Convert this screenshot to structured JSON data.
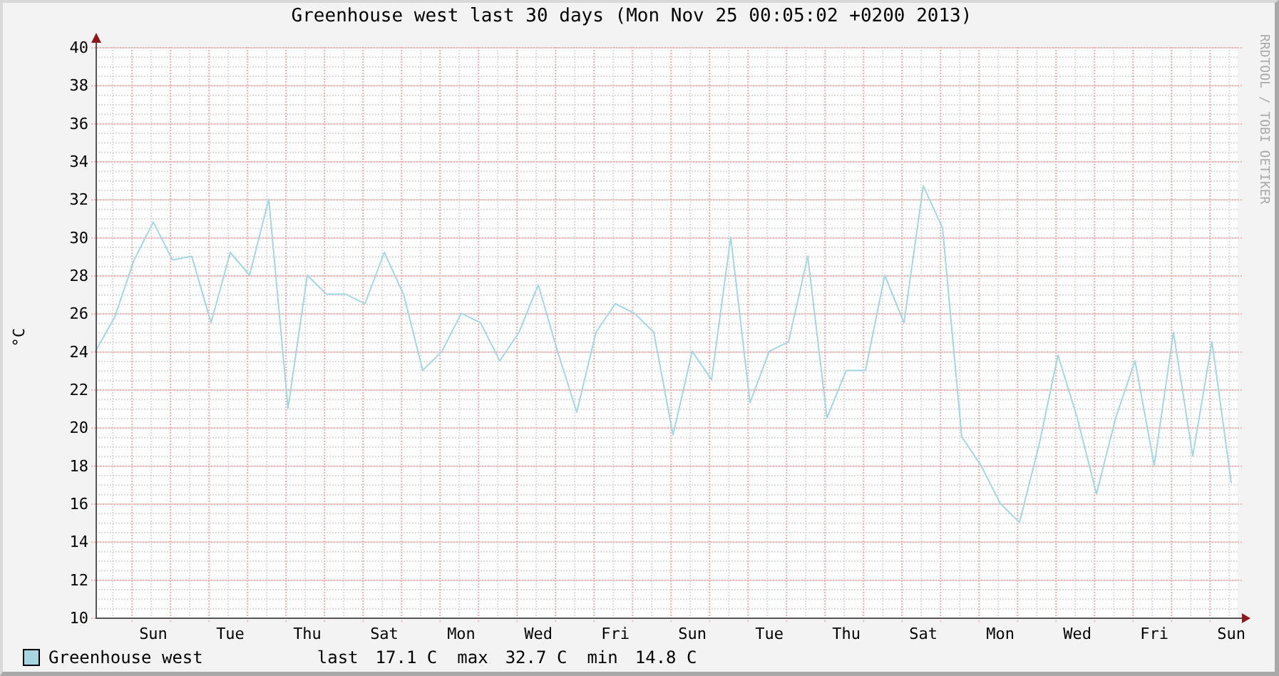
{
  "chart_data": {
    "type": "line",
    "title": "Greenhouse west last 30 days (Mon Nov 25 00:05:02 +0200 2013)",
    "ylabel": "°C",
    "categories": [
      null,
      null,
      null,
      "Sun",
      null,
      null,
      null,
      "Tue",
      null,
      null,
      null,
      "Thu",
      null,
      null,
      null,
      "Sat",
      null,
      null,
      null,
      "Mon",
      null,
      null,
      null,
      "Wed",
      null,
      null,
      null,
      "Fri",
      null,
      null,
      null,
      "Sun",
      null,
      null,
      null,
      "Tue",
      null,
      null,
      null,
      "Thu",
      null,
      null,
      null,
      "Sat",
      null,
      null,
      null,
      "Mon",
      null,
      null,
      null,
      "Wed",
      null,
      null,
      null,
      "Fri",
      null,
      null,
      null,
      "Sun"
    ],
    "series": [
      {
        "name": "Greenhouse west",
        "color": "#a6d6e2",
        "values": [
          24,
          25.8,
          28.8,
          30.8,
          28.8,
          29,
          25.5,
          29.2,
          28,
          32,
          21,
          28,
          27,
          27,
          26.5,
          29.2,
          27,
          23,
          24,
          26,
          25.5,
          23.5,
          25,
          27.5,
          24,
          20.8,
          25,
          26.5,
          26,
          25,
          19.6,
          24,
          22.5,
          30,
          21.3,
          24,
          24.5,
          29,
          20.5,
          23,
          23,
          28,
          25.5,
          32.7,
          30.5,
          19.5,
          18,
          16,
          15,
          19,
          23.8,
          20.5,
          16.5,
          20.5,
          23.5,
          18,
          25,
          18.5,
          24.5,
          17.1
        ]
      }
    ],
    "ylim": [
      10,
      40
    ],
    "grid": true,
    "yticks": [
      10,
      12,
      14,
      16,
      18,
      20,
      22,
      24,
      26,
      28,
      30,
      32,
      34,
      36,
      38,
      40
    ]
  },
  "credit": "RRDTOOL / TOBI OETIKER",
  "legend": {
    "stats": [
      {
        "label": "last",
        "value": "17.1 C"
      },
      {
        "label": "max",
        "value": "32.7 C"
      },
      {
        "label": "min",
        "value": "14.8 C"
      }
    ]
  }
}
